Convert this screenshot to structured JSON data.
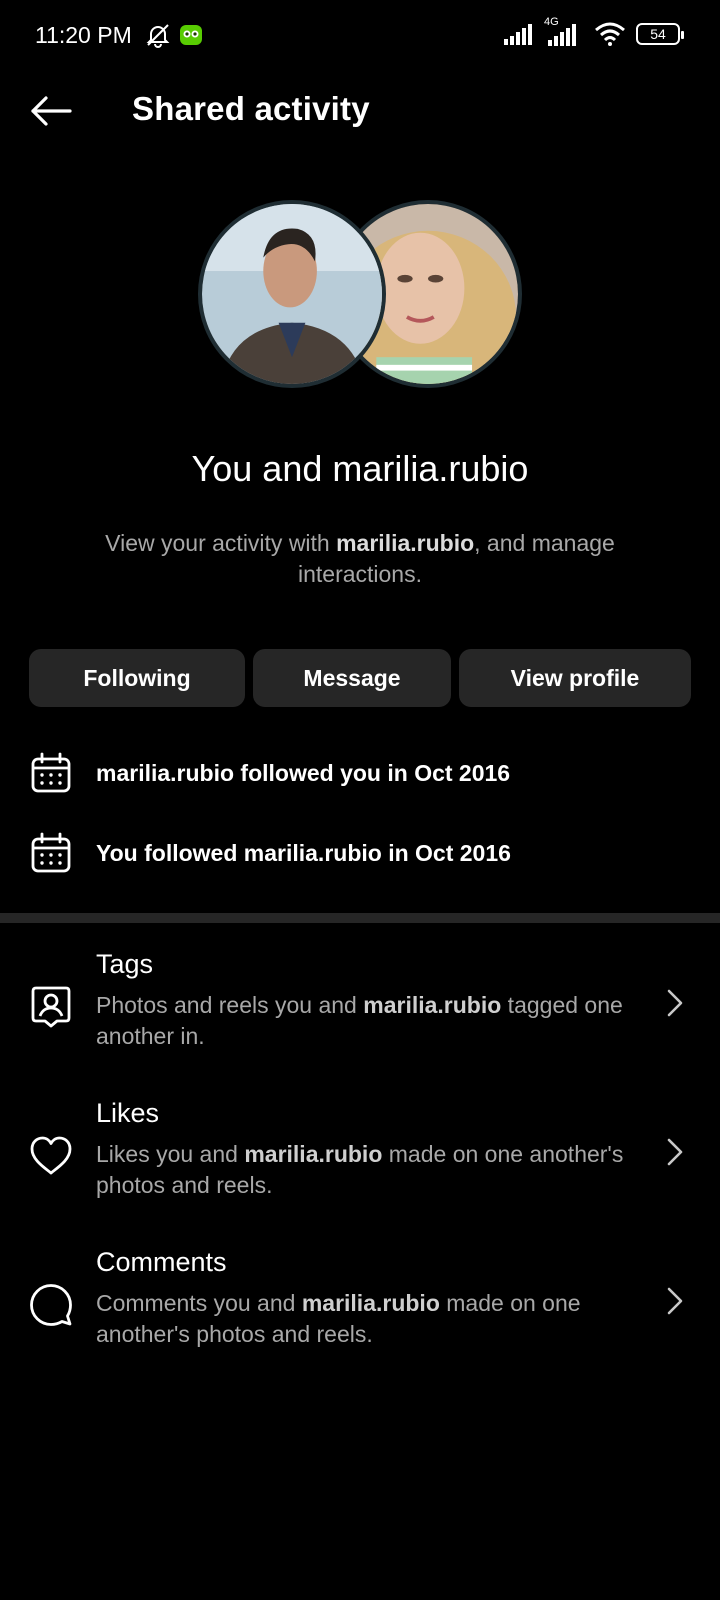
{
  "status": {
    "time": "11:20 PM",
    "network": "4G",
    "battery": "54"
  },
  "header": {
    "title": "Shared activity"
  },
  "pair_title": "You and marilia.rubio",
  "subtitle": {
    "pre": "View your activity with ",
    "username": "marilia.rubio",
    "post": ", and manage interactions."
  },
  "buttons": {
    "following": "Following",
    "message": "Message",
    "view_profile": "View profile"
  },
  "history": [
    {
      "text": "marilia.rubio followed you in Oct 2016"
    },
    {
      "text": "You followed marilia.rubio in Oct 2016"
    }
  ],
  "items": [
    {
      "title": "Tags",
      "pre": "Photos and reels you and ",
      "username": "marilia.rubio",
      "post": " tagged one another in."
    },
    {
      "title": "Likes",
      "pre": "Likes you and ",
      "username": "marilia.rubio",
      "post": " made on one another's photos and reels."
    },
    {
      "title": "Comments",
      "pre": "Comments you and ",
      "username": "marilia.rubio",
      "post": " made on one another's photos and reels."
    }
  ]
}
